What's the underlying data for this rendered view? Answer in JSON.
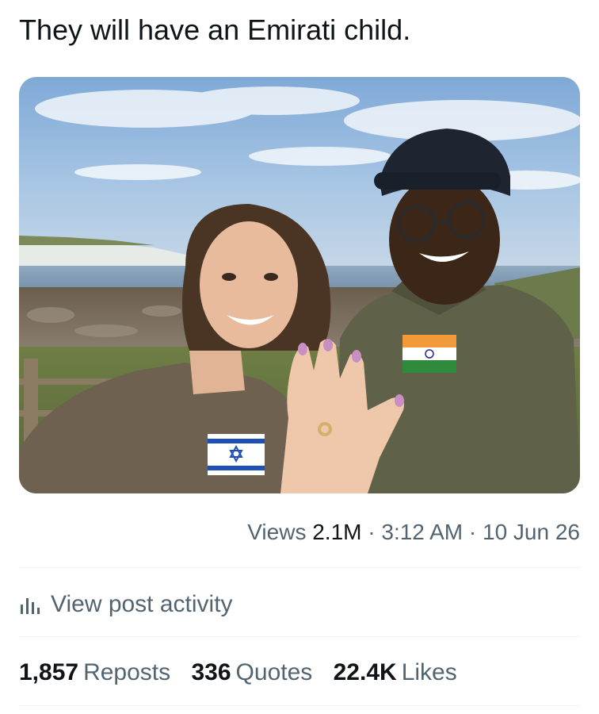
{
  "post": {
    "text": "They will have an Emirati child."
  },
  "meta": {
    "views_label": "Views",
    "views_count": "2.1M",
    "separator": "·",
    "time": "3:12 AM",
    "date": "10 Jun 26"
  },
  "activity": {
    "label": "View post activity",
    "icon": "analytics-bars-icon"
  },
  "stats": {
    "reposts_count": "1,857",
    "reposts_label": "Reposts",
    "quotes_count": "336",
    "quotes_label": "Quotes",
    "likes_count": "22.4K",
    "likes_label": "Likes"
  },
  "colors": {
    "text_primary": "#0f1419",
    "text_secondary": "#536471",
    "divider": "#eff3f4",
    "sky": "#8fb6dc",
    "jacket_green": "#6b6a52",
    "india_saffron": "#f29a3a",
    "india_green": "#2f8a3c",
    "israel_blue": "#1f4fb8"
  }
}
